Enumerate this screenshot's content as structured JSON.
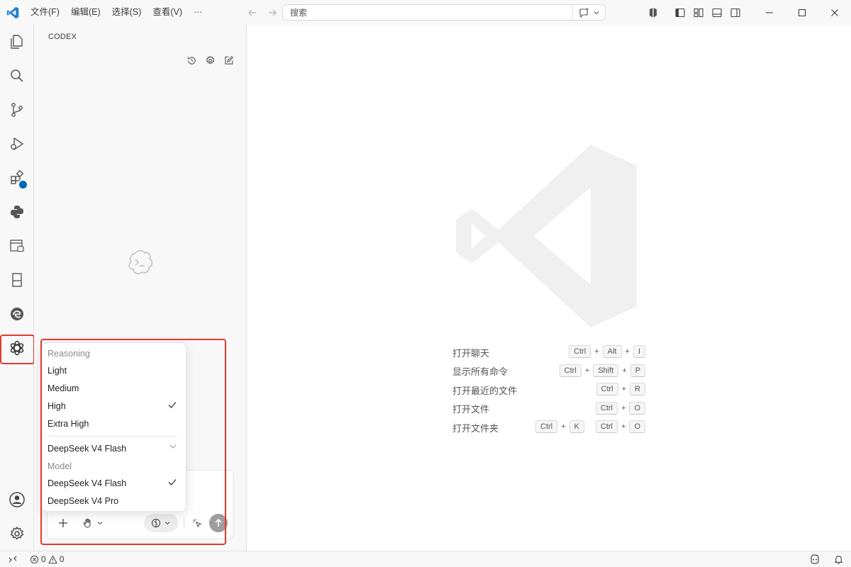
{
  "titlebar": {
    "menu": [
      "文件(F)",
      "编辑(E)",
      "选择(S)",
      "查看(V)",
      "···"
    ],
    "search_text": "搜索"
  },
  "sidebar": {
    "title": "CODEX"
  },
  "dropdown": {
    "reasoning_header": "Reasoning",
    "reasoning_options": [
      "Light",
      "Medium",
      "High",
      "Extra High"
    ],
    "reasoning_selected": "High",
    "model_current": "DeepSeek V4 Flash",
    "model_header": "Model",
    "model_options": [
      "DeepSeek V4 Flash",
      "DeepSeek V4 Pro"
    ],
    "model_selected": "DeepSeek V4 Flash"
  },
  "shortcuts": [
    {
      "label": "打开聊天",
      "keys": [
        [
          "Ctrl",
          "Alt",
          "I"
        ]
      ]
    },
    {
      "label": "显示所有命令",
      "keys": [
        [
          "Ctrl",
          "Shift",
          "P"
        ]
      ]
    },
    {
      "label": "打开最近的文件",
      "keys": [
        [
          "Ctrl",
          "R"
        ]
      ]
    },
    {
      "label": "打开文件",
      "keys": [
        [
          "Ctrl",
          "O"
        ]
      ]
    },
    {
      "label": "打开文件夹",
      "keys": [
        [
          "Ctrl",
          "K"
        ],
        [
          "Ctrl",
          "O"
        ]
      ]
    }
  ],
  "statusbar": {
    "errors": "0",
    "warnings": "0"
  },
  "colors": {
    "accent": "#0066b8",
    "highlight": "#e53a2f",
    "vscode_blue": "#1f7fd0"
  }
}
